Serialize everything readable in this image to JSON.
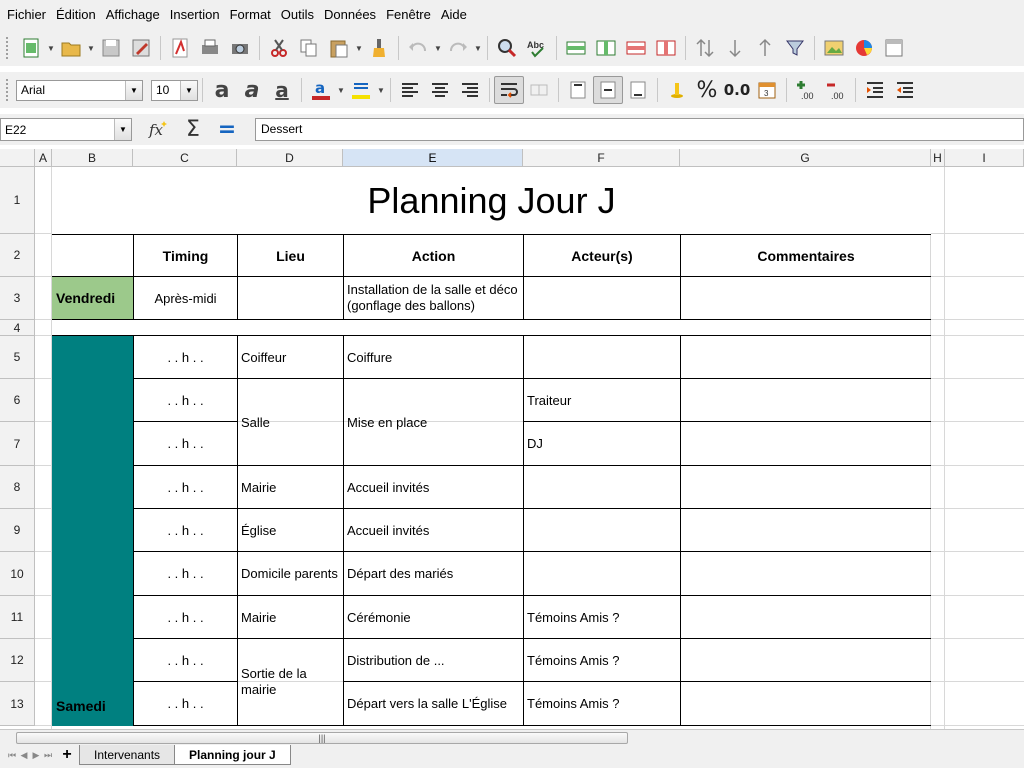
{
  "menu": [
    "Fichier",
    "Édition",
    "Affichage",
    "Insertion",
    "Format",
    "Outils",
    "Données",
    "Fenêtre",
    "Aide"
  ],
  "toolbar": {
    "font_name": "Arial",
    "font_size": "10",
    "icons1": [
      "new-doc-icon",
      "open-folder-icon",
      "save-icon",
      "edit-doc-icon",
      "export-pdf-icon",
      "print-icon",
      "print-preview-icon",
      "cut-icon",
      "copy-icon",
      "paste-icon",
      "clone-format-icon",
      "undo-icon",
      "redo-icon",
      "find-replace-icon",
      "spellcheck-icon",
      "row-insert-icon",
      "col-insert-icon",
      "row-delete-icon",
      "col-delete-icon",
      "sort-icon",
      "sort-desc-icon",
      "sort-asc-icon",
      "autofilter-icon",
      "image-icon",
      "chart-icon",
      "pivot-icon"
    ],
    "icons2": [
      "bold-icon",
      "italic-icon",
      "underline-icon",
      "font-color-icon",
      "highlight-icon",
      "align-left-icon",
      "align-center-icon",
      "align-right-icon",
      "wrap-text-icon",
      "merge-cells-icon",
      "align-top-icon",
      "align-middle-icon",
      "align-bottom-icon",
      "currency-icon",
      "percent-icon",
      "number-format-icon",
      "date-icon",
      "add-decimal-icon",
      "remove-decimal-icon",
      "indent-icon",
      "outdent-icon"
    ],
    "percent_glyph": "%",
    "number_glyph": "0.0",
    "bold_glyph": "a",
    "spell_label": "Abc"
  },
  "formula": {
    "cell_ref": "E22",
    "content": "Dessert",
    "sigma": "Σ",
    "equals": "="
  },
  "columns": [
    "A",
    "B",
    "C",
    "D",
    "E",
    "F",
    "G",
    "H",
    "I"
  ],
  "rows": [
    "1",
    "2",
    "3",
    "4",
    "5",
    "6",
    "7",
    "8",
    "9",
    "10",
    "11",
    "12",
    "13"
  ],
  "sheet": {
    "title": "Planning Jour J",
    "headers": {
      "timing": "Timing",
      "lieu": "Lieu",
      "action": "Action",
      "acteurs": "Acteur(s)",
      "commentaires": "Commentaires"
    },
    "day_friday": "Vendredi",
    "day_saturday": "Samedi",
    "r3": {
      "timing": "Après-midi",
      "action": "Installation de la salle et déco (gonflage des ballons)"
    },
    "r5": {
      "timing": ". . h . .",
      "lieu": "Coiffeur",
      "action": "Coiffure"
    },
    "r6": {
      "timing": ". . h . .",
      "acteurs": "Traiteur"
    },
    "r67": {
      "lieu": "Salle",
      "action": "Mise en place"
    },
    "r7": {
      "timing": ". . h . .",
      "acteurs": "DJ"
    },
    "r8": {
      "timing": ". . h . .",
      "lieu": "Mairie",
      "action": "Accueil invités"
    },
    "r9": {
      "timing": ". . h . .",
      "lieu": "Église",
      "action": "Accueil invités"
    },
    "r10": {
      "timing": ". . h . .",
      "lieu": "Domicile parents",
      "action": "Départ des mariés"
    },
    "r11": {
      "timing": ". . h . .",
      "lieu": "Mairie",
      "action": "Cérémonie",
      "acteurs": "Témoins Amis ?"
    },
    "r12": {
      "timing": ". . h . .",
      "action": "Distribution de ...",
      "acteurs": "Témoins Amis ?"
    },
    "r1213": {
      "lieu": "Sortie de la mairie"
    },
    "r13": {
      "timing": ". . h . .",
      "action": "Départ vers la salle L'Église",
      "acteurs": "Témoins Amis ?"
    }
  },
  "colors": {
    "friday": "#9cc98b",
    "saturday": "#008080",
    "selected_col": "#d6e4f5"
  },
  "tabs": [
    "Intervenants",
    "Planning jour J"
  ],
  "add_tab": "+",
  "scroll_grip": "|||"
}
